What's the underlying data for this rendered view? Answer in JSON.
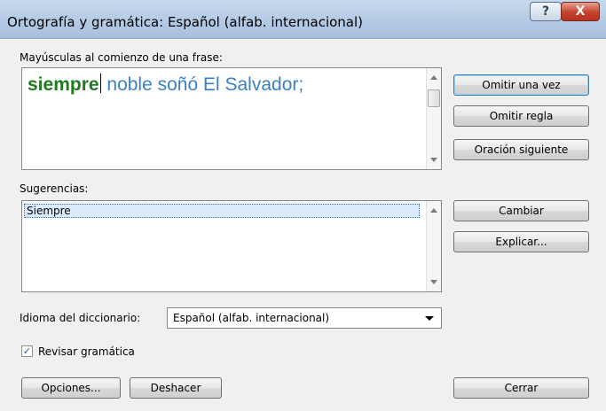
{
  "window": {
    "title": "Ortografía y gramática: Español (alfab. internacional)",
    "help_glyph": "?",
    "close_glyph": "X"
  },
  "issue": {
    "label": "Mayúsculas al comienzo de una frase:",
    "error_word": "siempre",
    "rest_text": "noble soñó El Salvador;"
  },
  "suggestions": {
    "label": "Sugerencias:",
    "items": [
      "Siempre"
    ]
  },
  "dictionary": {
    "label": "Idioma del diccionario:",
    "value": "Español (alfab. internacional)"
  },
  "check_grammar": {
    "label": "Revisar gramática",
    "checked": true,
    "check_glyph": "✓"
  },
  "buttons": {
    "ignore_once": "Omitir una vez",
    "ignore_rule": "Omitir regla",
    "next_sentence": "Oración siguiente",
    "change": "Cambiar",
    "explain": "Explicar...",
    "options": "Opciones...",
    "undo": "Deshacer",
    "close": "Cerrar"
  },
  "colors": {
    "error_word": "#1f7a1f",
    "sentence_text": "#3b80c3",
    "selection": "#dcebfc"
  }
}
